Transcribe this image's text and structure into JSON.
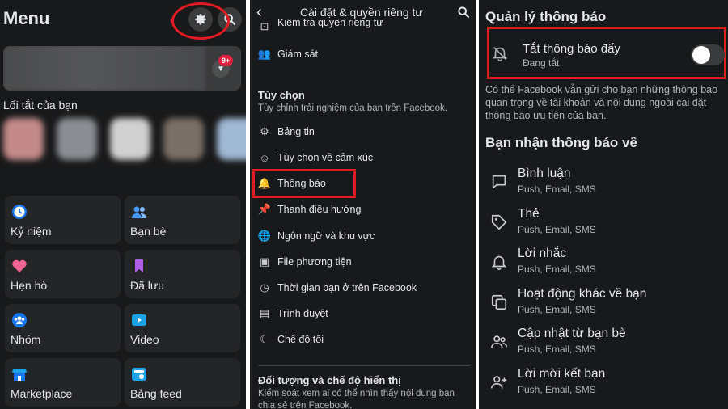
{
  "menu_panel": {
    "title": "Menu",
    "notif_badge": "9+",
    "shortcuts_title": "Lối tắt của bạn",
    "tiles": [
      {
        "label": "Kỷ niệm",
        "icon": "clock-icon"
      },
      {
        "label": "Bạn bè",
        "icon": "friends-icon"
      },
      {
        "label": "Hẹn hò",
        "icon": "heart-icon"
      },
      {
        "label": "Đã lưu",
        "icon": "bookmark-icon"
      },
      {
        "label": "Nhóm",
        "icon": "groups-icon"
      },
      {
        "label": "Video",
        "icon": "video-icon"
      },
      {
        "label": "Marketplace",
        "icon": "shop-icon"
      },
      {
        "label": "Bảng feed",
        "icon": "feed-icon"
      }
    ]
  },
  "settings_panel": {
    "title": "Cài đặt & quyền riêng tư",
    "top_items": [
      "Kiểm tra quyền riêng tư",
      "Giám sát"
    ],
    "preferences_title": "Tùy chọn",
    "preferences_desc": "Tùy chỉnh trải nghiệm của bạn trên Facebook.",
    "items": [
      {
        "label": "Bảng tin",
        "icon": "sliders-icon"
      },
      {
        "label": "Tùy chọn về cảm xúc",
        "icon": "reaction-icon"
      },
      {
        "label": "Thông báo",
        "icon": "bell-icon"
      },
      {
        "label": "Thanh điều hướng",
        "icon": "pin-icon"
      },
      {
        "label": "Ngôn ngữ và khu vực",
        "icon": "globe-icon"
      },
      {
        "label": "File phương tiện",
        "icon": "media-file-icon"
      },
      {
        "label": "Thời gian bạn ở trên Facebook",
        "icon": "clock-icon"
      },
      {
        "label": "Trình duyệt",
        "icon": "browser-icon"
      },
      {
        "label": "Chế độ tối",
        "icon": "moon-icon"
      }
    ],
    "audience_title": "Đối tượng và chế độ hiển thị",
    "audience_desc": "Kiểm soát xem ai có thể nhìn thấy nội dung bạn chia sẻ trên Facebook."
  },
  "notif_panel": {
    "title": "Quản lý thông báo",
    "mute_label": "Tắt thông báo đẩy",
    "mute_status": "Đang tắt",
    "mute_enabled": false,
    "note": "Có thể Facebook vẫn gửi cho bạn những thông báo quan trọng về tài khoản và nội dung ngoài cài đặt thông báo ưu tiên của bạn.",
    "receive_title": "Bạn nhận thông báo về",
    "rows": [
      {
        "label": "Bình luận",
        "channels": "Push, Email, SMS",
        "icon": "comment-icon"
      },
      {
        "label": "Thẻ",
        "channels": "Push, Email, SMS",
        "icon": "tag-icon"
      },
      {
        "label": "Lời nhắc",
        "channels": "Push, Email, SMS",
        "icon": "bell-icon"
      },
      {
        "label": "Hoạt động khác về bạn",
        "channels": "Push, Email, SMS",
        "icon": "activity-icon"
      },
      {
        "label": "Cập nhật từ bạn bè",
        "channels": "Push, Email, SMS",
        "icon": "friends-icon"
      },
      {
        "label": "Lời mời kết bạn",
        "channels": "Push, Email, SMS",
        "icon": "add-friend-icon"
      }
    ]
  },
  "colors": {
    "background": "#18191a",
    "tile": "#242526",
    "highlight": "#e01b22",
    "badge": "#e41e3f"
  }
}
